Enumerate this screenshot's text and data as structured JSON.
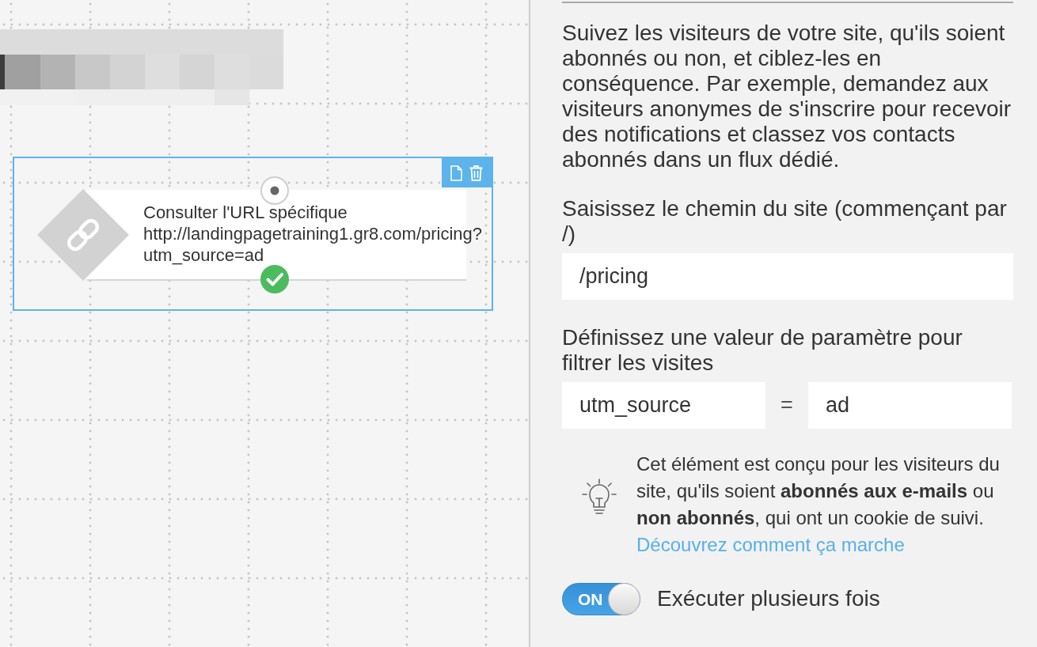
{
  "canvas": {
    "node": {
      "selected": true,
      "title": "Consulter l'URL spécifique",
      "url": "http://landingpagetraining1.gr8.com/pricing?utm_source=ad"
    }
  },
  "panel": {
    "description": "Suivez les visiteurs de votre site, qu'ils soient abonnés ou non, et ciblez-les en conséquence. Par exemple, demandez aux visiteurs anonymes de s'inscrire pour recevoir des notifications et classez vos contacts abonnés dans un flux dédié.",
    "path_field": {
      "label": "Saisissez le chemin du site (commençant par /)",
      "value": "/pricing"
    },
    "parameter_field": {
      "label": "Définissez une valeur de paramètre pour filtrer les visites",
      "name_value": "utm_source",
      "operator": "=",
      "value": "ad"
    },
    "tip": {
      "text": "Cet élément est conçu pour les visiteurs du site, qu'ils soient **abonnés aux e-mails** ou **non abonnés**, qui ont un cookie de suivi.",
      "link": "Découvrez comment ça marche"
    },
    "toggle": {
      "on": true,
      "state_label": "ON",
      "label": "Exécuter plusieurs fois"
    }
  }
}
